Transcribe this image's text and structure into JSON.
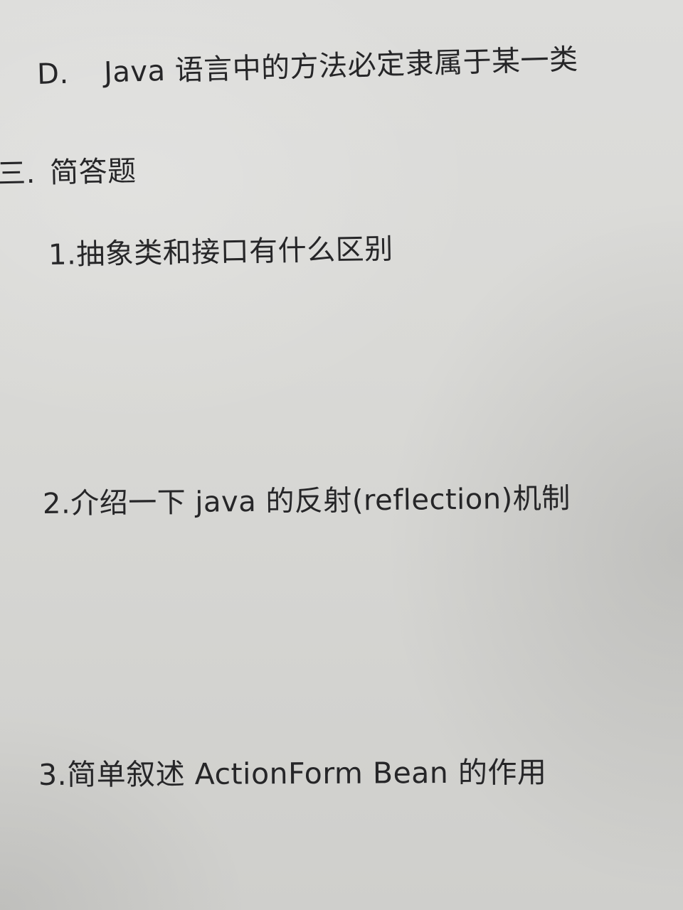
{
  "option_d": {
    "marker": "D.",
    "text": "Java 语言中的方法必定隶属于某一类"
  },
  "section": {
    "number": "三.",
    "title": "简答题"
  },
  "questions": [
    {
      "text": "1.抽象类和接口有什么区别"
    },
    {
      "text": "2.介绍一下 java 的反射(reflection)机制"
    },
    {
      "text": "3.简单叙述 ActionForm Bean 的作用"
    }
  ]
}
